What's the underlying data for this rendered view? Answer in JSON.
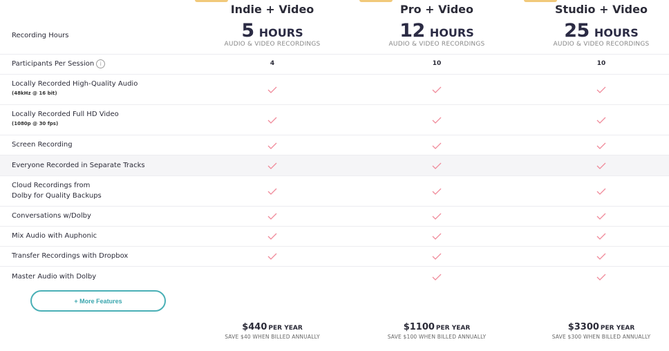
{
  "row_header_recording_hours": "Recording Hours",
  "plans": [
    {
      "name": "Indie + Video",
      "hours": "5",
      "unit": "HOURS",
      "hours_sub": "AUDIO & VIDEO RECORDINGS",
      "participants": "4",
      "price": "$440",
      "per": "PER YEAR",
      "save": "SAVE $40 WHEN BILLED ANNUALLY"
    },
    {
      "name": "Pro + Video",
      "hours": "12",
      "unit": "HOURS",
      "hours_sub": "AUDIO & VIDEO RECORDINGS",
      "participants": "10",
      "price": "$1100",
      "per": "PER YEAR",
      "save": "SAVE $100 WHEN BILLED ANNUALLY"
    },
    {
      "name": "Studio + Video",
      "hours": "25",
      "unit": "HOURS",
      "hours_sub": "AUDIO & VIDEO RECORDINGS",
      "participants": "10",
      "price": "$3300",
      "per": "PER YEAR",
      "save": "SAVE $300 WHEN BILLED ANNUALLY"
    }
  ],
  "features": [
    {
      "label": "Participants Per Session",
      "info": "i"
    },
    {
      "label": "Locally Recorded High-Quality Audio",
      "small": "(48kHz @ 16 bit)",
      "checks": [
        true,
        true,
        true
      ]
    },
    {
      "label": "Locally Recorded Full HD Video",
      "small": "(1080p @ 30 fps)",
      "checks": [
        true,
        true,
        true
      ]
    },
    {
      "label": "Screen Recording",
      "checks": [
        true,
        true,
        true
      ]
    },
    {
      "label": "Everyone Recorded in Separate Tracks",
      "checks": [
        true,
        true,
        true
      ]
    },
    {
      "label": "Cloud Recordings from",
      "label2": "Dolby for Quality Backups",
      "checks": [
        true,
        true,
        true
      ]
    },
    {
      "label": "Conversations w/Dolby",
      "checks": [
        true,
        true,
        true
      ]
    },
    {
      "label": "Mix Audio with Auphonic",
      "checks": [
        true,
        true,
        true
      ]
    },
    {
      "label": "Transfer Recordings with Dropbox",
      "checks": [
        true,
        true,
        true
      ]
    },
    {
      "label": "Master Audio with Dolby",
      "checks": [
        false,
        true,
        true
      ]
    }
  ],
  "more_features_label": "+ More Features",
  "colors": {
    "check": "#f08a9a",
    "accent": "#4ab0b6",
    "tab": "#f1c97a"
  }
}
